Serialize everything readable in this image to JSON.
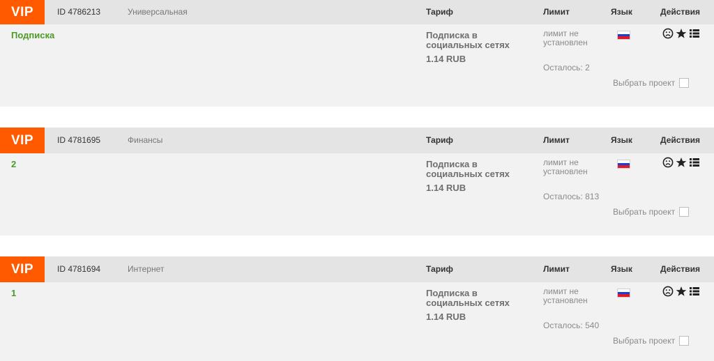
{
  "colors": {
    "vip": "#ff5a00",
    "title_green": "#4c9a2a",
    "header_bg": "#e4e4e4",
    "body_bg": "#f2f2f2"
  },
  "projects": [
    {
      "badge": "VIP",
      "id": "ID 4786213",
      "category": "Универсальная",
      "h_tariff": "Тариф",
      "h_limit": "Лимит",
      "h_lang": "Язык",
      "h_actions": "Действия",
      "title": "Подписка",
      "tariff_name": "Подписка в социальных сетях",
      "tariff_price": "1.14 RUB",
      "limit": "лимит не установлен",
      "remaining": "Осталось: 2",
      "language_flag": "russia-flag-icon",
      "choose": "Выбрать проект"
    },
    {
      "badge": "VIP",
      "id": "ID 4781695",
      "category": "Финансы",
      "h_tariff": "Тариф",
      "h_limit": "Лимит",
      "h_lang": "Язык",
      "h_actions": "Действия",
      "title": "2",
      "tariff_name": "Подписка в социальных сетях",
      "tariff_price": "1.14 RUB",
      "limit": "лимит не установлен",
      "remaining": "Осталось: 813",
      "language_flag": "russia-flag-icon",
      "choose": "Выбрать проект"
    },
    {
      "badge": "VIP",
      "id": "ID 4781694",
      "category": "Интернет",
      "h_tariff": "Тариф",
      "h_limit": "Лимит",
      "h_lang": "Язык",
      "h_actions": "Действия",
      "title": "1",
      "tariff_name": "Подписка в социальных сетях",
      "tariff_price": "1.14 RUB",
      "limit": "лимит не установлен",
      "remaining": "Осталось: 540",
      "language_flag": "russia-flag-icon",
      "choose": "Выбрать проект"
    }
  ]
}
